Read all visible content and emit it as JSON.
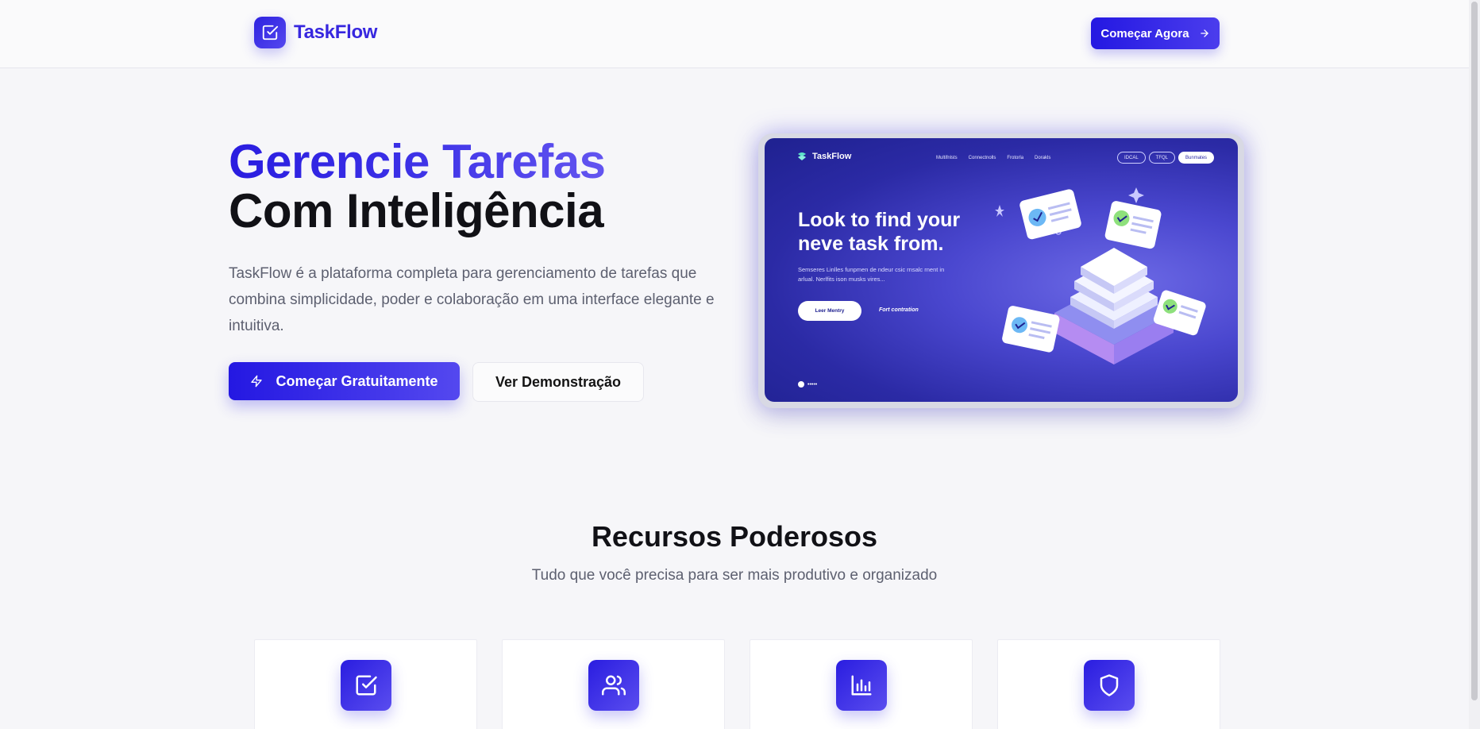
{
  "header": {
    "logo_text": "TaskFlow",
    "cta_label": "Começar Agora"
  },
  "hero": {
    "title_line1": "Gerencie Tarefas",
    "title_line2": "Com Inteligência",
    "description": "TaskFlow é a plataforma completa para gerenciamento de tarefas que combina simplicidade, poder e colaboração em uma interface elegante e intuitiva.",
    "primary_button": "Começar Gratuitamente",
    "secondary_button": "Ver Demonstração",
    "image": {
      "brand": "TaskFlow",
      "nav_links": [
        "Multifnlsts",
        "Connectnolls",
        "Frotorla",
        "Dorakls"
      ],
      "pills": [
        "IDCAL",
        "TFQL",
        "Bunmates"
      ],
      "headline_line1": "Look to find your",
      "headline_line2": "neve task from.",
      "subtext": "Semseres Linlles funpmen de ndeur csic rnsalc rnent in arlual. Nerlfits ison musks vires...",
      "button": "Leer Mentry",
      "link": "Fort contration",
      "dots": "•••••"
    }
  },
  "features": {
    "title": "Recursos Poderosos",
    "subtitle": "Tudo que você precisa para ser mais produtivo e organizado",
    "cards": [
      {
        "icon": "checkbox-icon"
      },
      {
        "icon": "users-icon"
      },
      {
        "icon": "bar-chart-icon"
      },
      {
        "icon": "shield-icon"
      }
    ]
  },
  "colors": {
    "primary": "#2a1de0",
    "primary_light": "#5a4def",
    "text_dark": "#111116",
    "text_muted": "#5d6070"
  }
}
